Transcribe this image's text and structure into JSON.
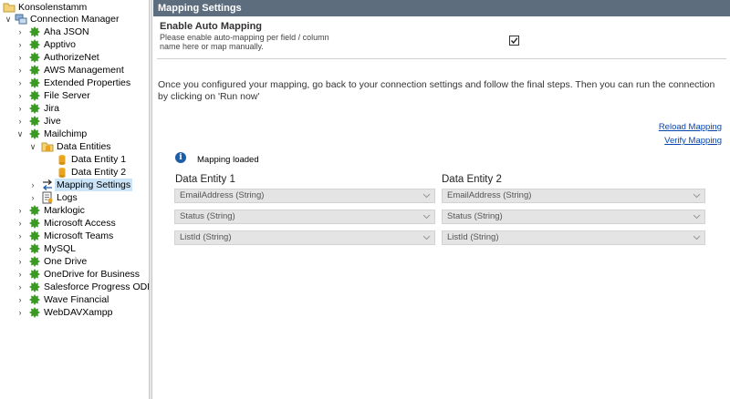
{
  "tree": {
    "root": "Konsolenstamm",
    "manager": "Connection Manager",
    "connections": [
      "Aha JSON",
      "Apptivo",
      "AuthorizeNet",
      "AWS Management",
      "Extended Properties",
      "File Server",
      "Jira",
      "Jive",
      "Mailchimp"
    ],
    "mailchimp_children": {
      "data_entities": "Data Entities",
      "entity1": "Data Entity 1",
      "entity2": "Data Entity 2",
      "mapping_settings": "Mapping Settings",
      "logs": "Logs"
    },
    "connections_after": [
      "Marklogic",
      "Microsoft Access",
      "Microsoft Teams",
      "MySQL",
      "One Drive",
      "OneDrive for Business",
      "Salesforce Progress ODBC",
      "Wave Financial",
      "WebDAVXampp"
    ]
  },
  "panel": {
    "header": "Mapping Settings",
    "auto_mapping_title": "Enable Auto Mapping",
    "auto_mapping_desc": "Please enable auto-mapping per field / column name here or map manually.",
    "auto_mapping_checked": true,
    "info": "Once you configured your mapping, go back to your connection settings and follow the final steps. Then you can run the connection by clicking on 'Run now'",
    "reload_link": "Reload Mapping",
    "verify_link": "Verify Mapping",
    "status": "Mapping loaded",
    "col1_header": "Data Entity 1",
    "col2_header": "Data Entity 2",
    "rows": [
      {
        "left": "EmailAddress (String)",
        "right": "EmailAddress (String)"
      },
      {
        "left": "Status (String)",
        "right": "Status (String)"
      },
      {
        "left": "ListId (String)",
        "right": "ListId (String)"
      }
    ]
  },
  "colors": {
    "header_bg": "#5d6d7e",
    "selection": "#cce4f7",
    "link": "#0645ad",
    "plugin_green": "#3a9a24"
  }
}
